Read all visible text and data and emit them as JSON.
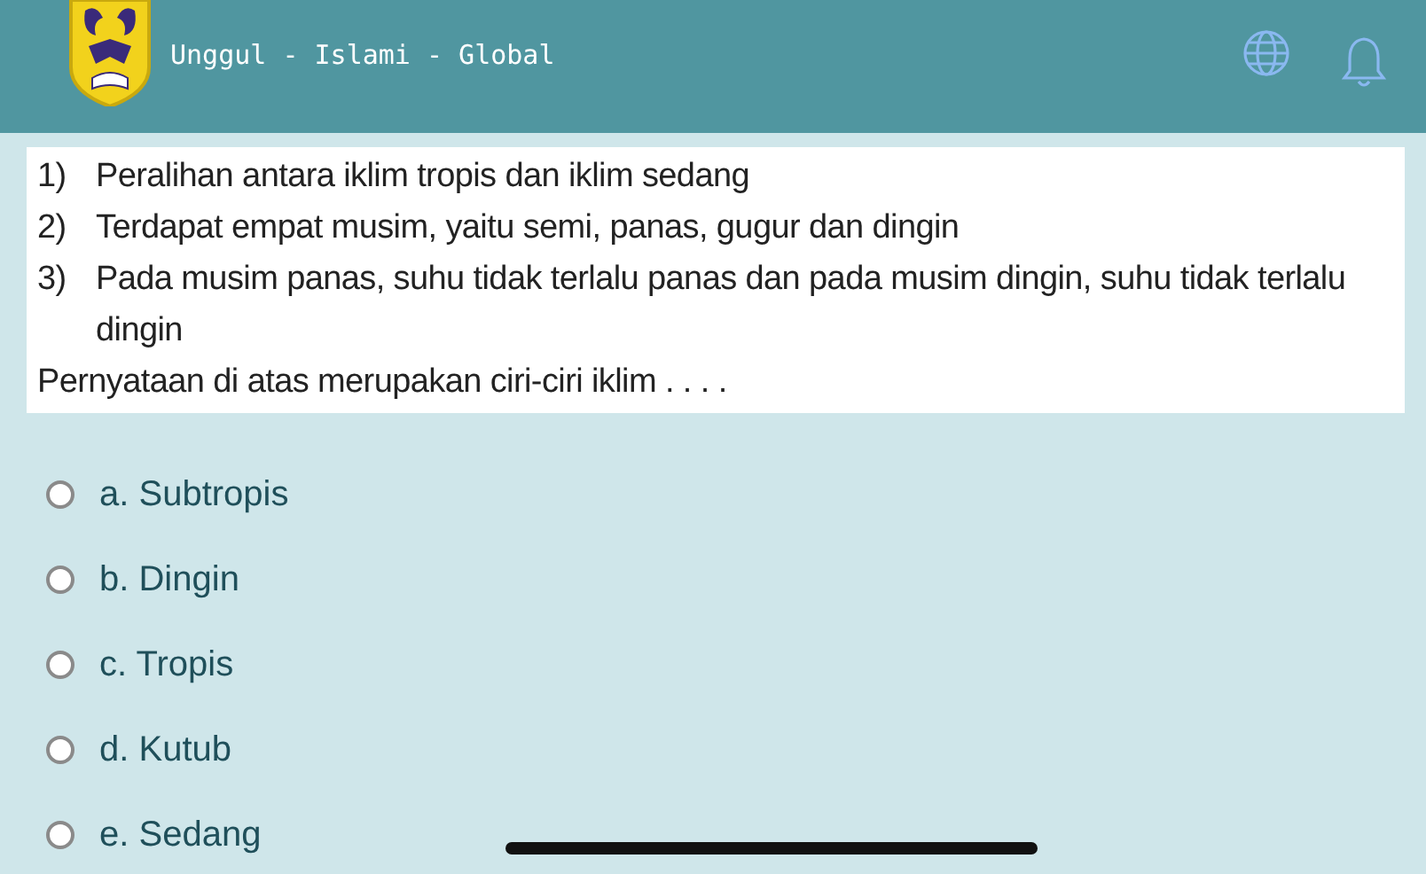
{
  "header": {
    "tagline": "Unggul - Islami - Global"
  },
  "question": {
    "statements": [
      {
        "number": "1)",
        "text": "Peralihan antara iklim tropis dan iklim sedang"
      },
      {
        "number": "2)",
        "text": "Terdapat empat musim, yaitu semi, panas, gugur dan dingin"
      },
      {
        "number": "3)",
        "text": "Pada musim panas, suhu tidak terlalu panas dan pada musim dingin, suhu tidak terlalu dingin"
      }
    ],
    "prompt": "Pernyataan di atas merupakan ciri-ciri iklim . . . ."
  },
  "options": [
    {
      "label": "a. Subtropis",
      "selected": false
    },
    {
      "label": "b. Dingin",
      "selected": false
    },
    {
      "label": "c. Tropis",
      "selected": false
    },
    {
      "label": "d. Kutub",
      "selected": false
    },
    {
      "label": "e. Sedang",
      "selected": false
    }
  ]
}
